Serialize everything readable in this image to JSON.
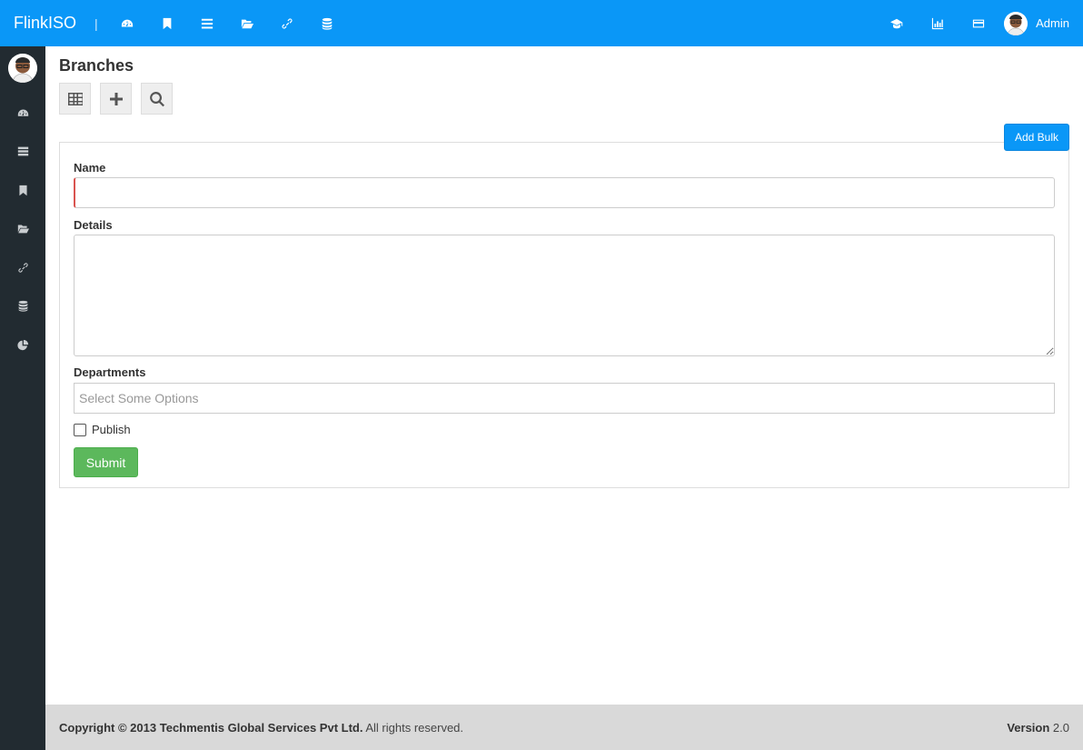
{
  "brand": "FlinkISO",
  "separator": "|",
  "user": {
    "name": "Admin"
  },
  "nav_icons": [
    "dashboard-icon",
    "bookmark-icon",
    "list-icon",
    "folder-open-icon",
    "link-icon",
    "database-icon"
  ],
  "right_icons": [
    "graduation-cap-icon",
    "bar-chart-icon",
    "credit-card-icon"
  ],
  "sidebar_icons": [
    "dashboard-icon",
    "server-icon",
    "bookmark-icon",
    "folder-open-icon",
    "link-icon",
    "database-icon",
    "pie-chart-icon"
  ],
  "page": {
    "title": "Branches",
    "add_bulk_label": "Add Bulk"
  },
  "form": {
    "name_label": "Name",
    "name_value": "",
    "details_label": "Details",
    "details_value": "",
    "departments_label": "Departments",
    "departments_placeholder": "Select Some Options",
    "publish_label": "Publish",
    "publish_checked": false,
    "submit_label": "Submit"
  },
  "footer": {
    "copyright_prefix": "Copyright © 2013",
    "company": "Techmentis Global Services Pvt Ltd.",
    "rights": "All rights reserved.",
    "version_label": "Version",
    "version_value": "2.0"
  },
  "colors": {
    "topbar": "#0a97f7",
    "sidebar": "#222b31",
    "submit": "#5cb85c",
    "footer": "#d9d9d9"
  }
}
